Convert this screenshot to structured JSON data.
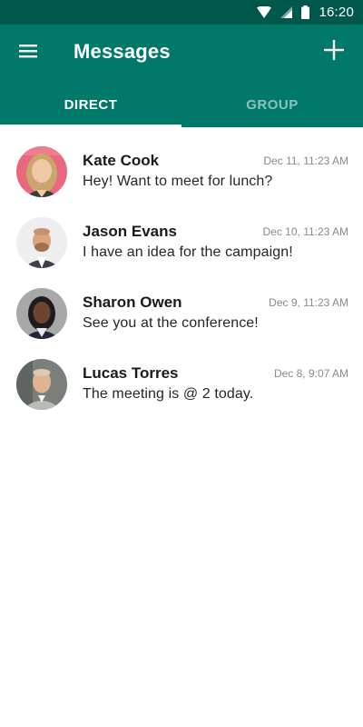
{
  "status_bar": {
    "time": "16:20",
    "icons": [
      "wifi-icon",
      "signal-icon",
      "battery-icon"
    ]
  },
  "header": {
    "title": "Messages",
    "menu_icon": "hamburger-menu-icon",
    "add_icon": "plus-icon"
  },
  "tabs": [
    {
      "label": "DIRECT",
      "active": true
    },
    {
      "label": "GROUP",
      "active": false
    }
  ],
  "colors": {
    "status_bar": "#00574b",
    "app_bar": "#00796b",
    "text_primary": "#1a1a1a",
    "text_secondary": "#8a8a8a"
  },
  "messages": [
    {
      "name": "Kate Cook",
      "time": "Dec 11, 11:23 AM",
      "preview": "Hey! Want to meet for lunch?"
    },
    {
      "name": "Jason Evans",
      "time": "Dec 10, 11:23 AM",
      "preview": "I have an idea for the campaign!"
    },
    {
      "name": "Sharon Owen",
      "time": "Dec 9, 11:23 AM",
      "preview": "See you at the conference!"
    },
    {
      "name": "Lucas Torres",
      "time": "Dec 8, 9:07 AM",
      "preview": "The meeting is @ 2 today."
    }
  ]
}
